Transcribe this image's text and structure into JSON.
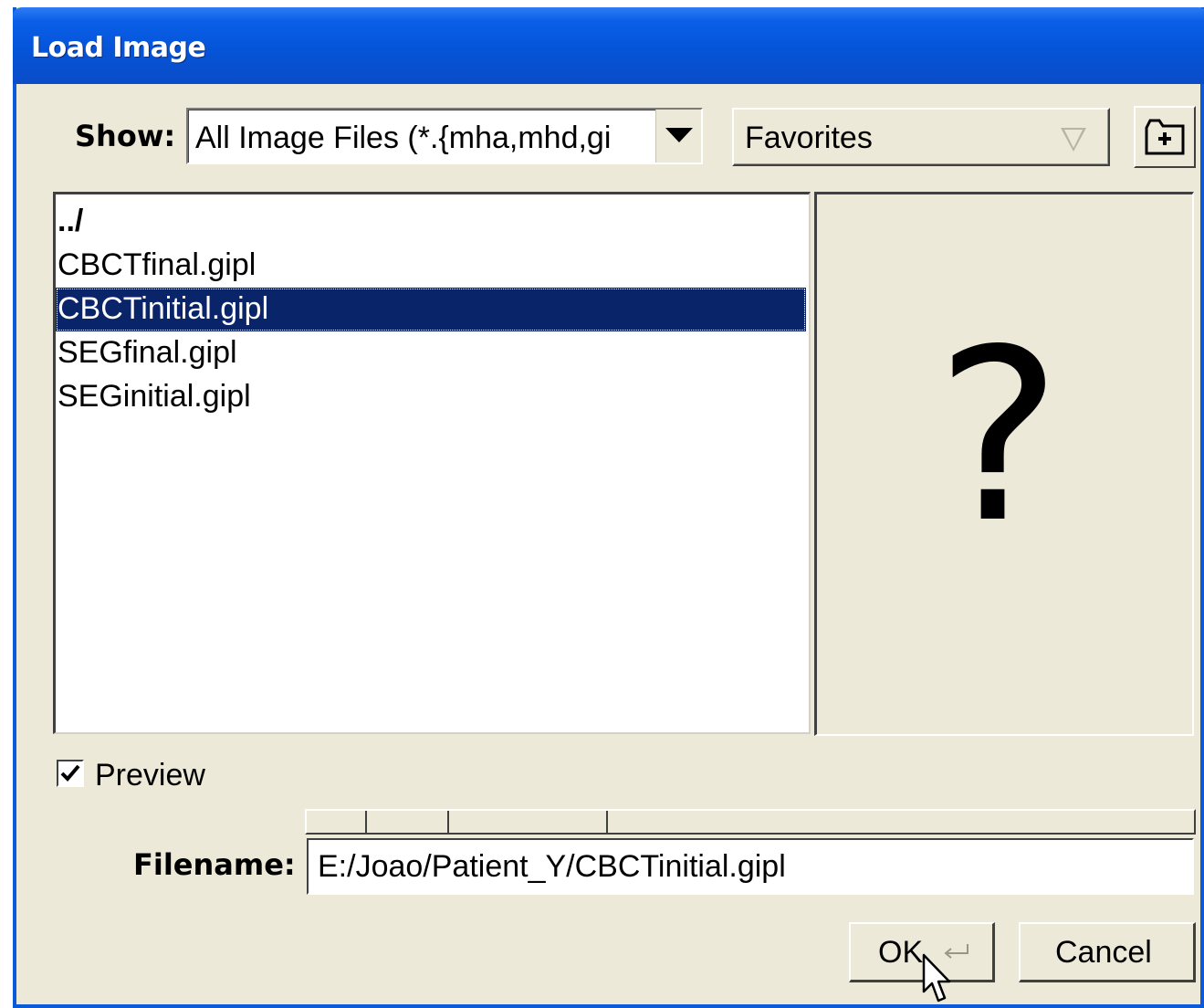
{
  "window": {
    "title": "Load Image"
  },
  "filter": {
    "label": "Show:",
    "value": "All Image Files (*.{mha,mhd,gi"
  },
  "favorites": {
    "value": "Favorites"
  },
  "new_folder_icon": "new-folder-icon",
  "files": [
    {
      "name": "../",
      "type": "parent"
    },
    {
      "name": "CBCTfinal.gipl",
      "type": "file"
    },
    {
      "name": "CBCTinitial.gipl",
      "type": "file",
      "selected": true
    },
    {
      "name": "SEGfinal.gipl",
      "type": "file"
    },
    {
      "name": "SEGinitial.gipl",
      "type": "file"
    }
  ],
  "preview": {
    "placeholder": "?",
    "checkbox_label": "Preview",
    "checked": true
  },
  "filename": {
    "label": "Filename:",
    "value": "E:/Joao/Patient_Y/CBCTinitial.gipl"
  },
  "buttons": {
    "ok": "OK",
    "cancel": "Cancel"
  },
  "colors": {
    "titlebar": "#0554d8",
    "selection": "#0a246a",
    "dialog_bg": "#ece9d8"
  }
}
